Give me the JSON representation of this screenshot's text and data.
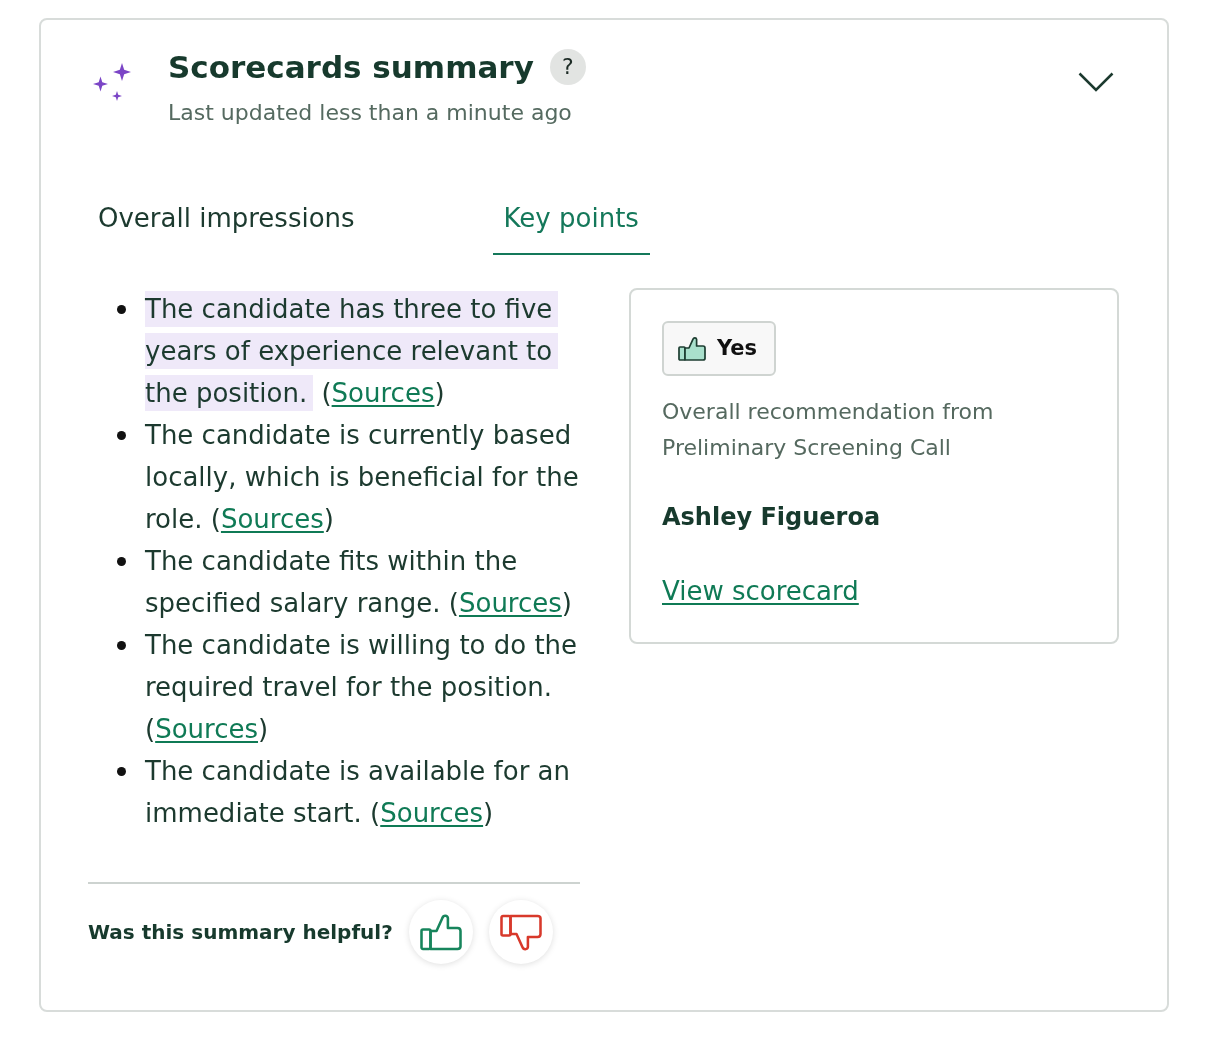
{
  "header": {
    "title": "Scorecards summary",
    "help": "?",
    "subtitle": "Last updated less than a minute ago"
  },
  "tabs": [
    {
      "label": "Overall impressions",
      "selected": false
    },
    {
      "label": "Key points",
      "selected": true
    }
  ],
  "key_points": [
    {
      "text": "The candidate has three to five years of experience relevant to the position.",
      "highlighted": true,
      "link_prefix": "(",
      "link": "Sources",
      "link_suffix": ")"
    },
    {
      "text": "The candidate is currently based locally, which is beneficial for the role.",
      "highlighted": false,
      "link_prefix": "(",
      "link": "Sources",
      "link_suffix": ")"
    },
    {
      "text": "The candidate fits within the specified salary range.",
      "highlighted": false,
      "link_prefix": "(",
      "link": "Sources",
      "link_suffix": ")"
    },
    {
      "text": "The candidate is willing to do the required travel for the position.",
      "highlighted": false,
      "link_prefix": "(",
      "link": "Sources",
      "link_suffix": ")"
    },
    {
      "text": "The candidate is available for an immediate start.",
      "highlighted": false,
      "link_prefix": "(",
      "link": "Sources",
      "link_suffix": ")"
    }
  ],
  "recommendation": {
    "badge": "Yes",
    "description": "Overall recommendation from Preliminary Screening Call",
    "interviewer": "Ashley Figueroa",
    "link": "View scorecard"
  },
  "feedback": {
    "question": "Was this summary helpful?"
  }
}
